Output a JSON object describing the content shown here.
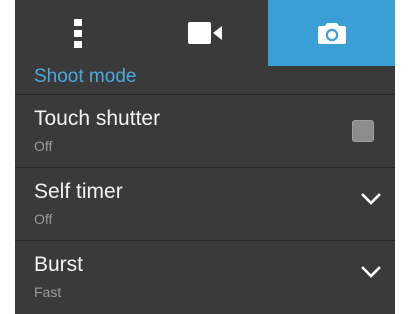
{
  "tabs": [
    {
      "icon": "more-vert-icon",
      "label": ""
    },
    {
      "icon": "video-camera-icon",
      "label": ""
    },
    {
      "icon": "camera-icon",
      "label": "",
      "active": true
    }
  ],
  "section": {
    "title": "Shoot mode"
  },
  "settings": [
    {
      "title": "Touch shutter",
      "value": "Off",
      "control": "checkbox",
      "checked": false
    },
    {
      "title": "Self timer",
      "value": "Off",
      "control": "dropdown"
    },
    {
      "title": "Burst",
      "value": "Fast",
      "control": "dropdown"
    }
  ],
  "colors": {
    "accent": "#3a9fd4",
    "background": "#3a3a3a",
    "header_text": "#4aa8e0"
  }
}
